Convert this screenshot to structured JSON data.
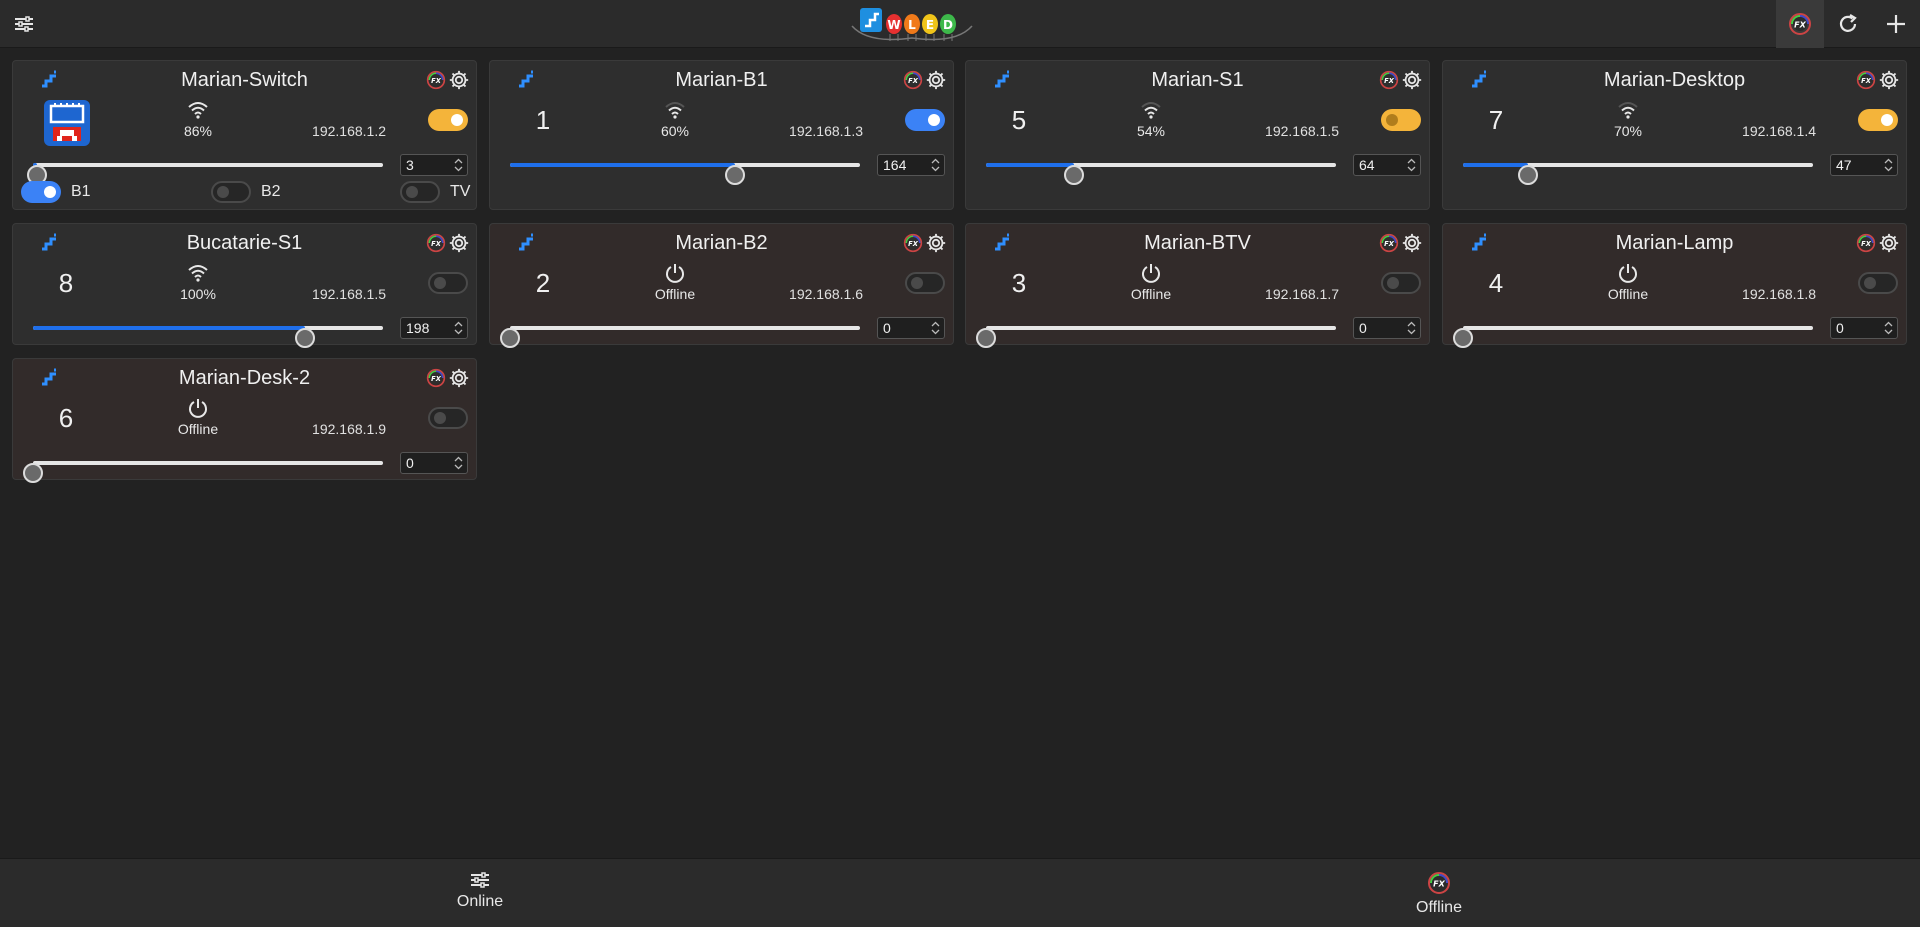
{
  "header": {
    "menu_icon": "sliders-icon",
    "logo": "wled-logo",
    "actions": [
      {
        "icon": "fx-icon",
        "active": true
      },
      {
        "icon": "refresh-icon",
        "active": false
      },
      {
        "icon": "plus-icon",
        "active": false
      }
    ]
  },
  "devices": [
    {
      "name": "Marian-Switch",
      "badge": "",
      "status": "86%",
      "ip": "192.168.1.2",
      "on": true,
      "on_color": "amber",
      "brightness": 3,
      "brightness_text": "3",
      "offline": false,
      "has_image": true,
      "segments": [
        {
          "label": "B1",
          "on": true
        },
        {
          "label": "B2",
          "on": false
        },
        {
          "label": "TV",
          "on": false
        }
      ]
    },
    {
      "name": "Marian-B1",
      "badge": "1",
      "status": "60%",
      "ip": "192.168.1.3",
      "on": true,
      "on_color": "blue",
      "brightness": 164,
      "brightness_text": "164",
      "offline": false
    },
    {
      "name": "Marian-S1",
      "badge": "5",
      "status": "54%",
      "ip": "192.168.1.5",
      "on": true,
      "on_color": "amber-half",
      "brightness": 64,
      "brightness_text": "64",
      "offline": false
    },
    {
      "name": "Marian-Desktop",
      "badge": "7",
      "status": "70%",
      "ip": "192.168.1.4",
      "on": true,
      "on_color": "amber",
      "brightness": 47,
      "brightness_text": "47",
      "offline": false
    },
    {
      "name": "Bucatarie-S1",
      "badge": "8",
      "status": "100%",
      "ip": "192.168.1.5",
      "on": false,
      "on_color": "",
      "brightness": 198,
      "brightness_text": "198",
      "offline": false
    },
    {
      "name": "Marian-B2",
      "badge": "2",
      "status": "Offline",
      "ip": "192.168.1.6",
      "on": false,
      "on_color": "",
      "brightness": 0,
      "brightness_text": "0",
      "offline": true
    },
    {
      "name": "Marian-BTV",
      "badge": "3",
      "status": "Offline",
      "ip": "192.168.1.7",
      "on": false,
      "on_color": "",
      "brightness": 0,
      "brightness_text": "0",
      "offline": true
    },
    {
      "name": "Marian-Lamp",
      "badge": "4",
      "status": "Offline",
      "ip": "192.168.1.8",
      "on": false,
      "on_color": "",
      "brightness": 0,
      "brightness_text": "0",
      "offline": true
    },
    {
      "name": "Marian-Desk-2",
      "badge": "6",
      "status": "Offline",
      "ip": "192.168.1.9",
      "on": false,
      "on_color": "",
      "brightness": 0,
      "brightness_text": "0",
      "offline": true
    }
  ],
  "bottom_nav": [
    {
      "label": "Online",
      "icon": "sliders-icon"
    },
    {
      "label": "Offline",
      "icon": "fx-icon"
    }
  ],
  "colors": {
    "accent_blue": "#1f6feb",
    "toggle_blue": "#3b82f6",
    "toggle_amber": "#f4b43a",
    "background": "#222222"
  }
}
